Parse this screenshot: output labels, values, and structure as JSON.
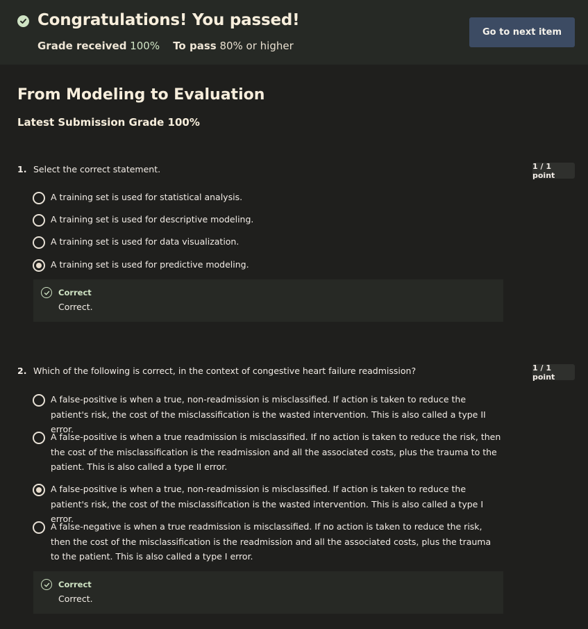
{
  "banner": {
    "title": "Congratulations! You passed!",
    "grade_label": "Grade received",
    "grade_value": "100%",
    "pass_label": "To pass",
    "pass_value": "80% or higher",
    "next_button": "Go to next item"
  },
  "page": {
    "title": "From Modeling to Evaluation",
    "latest_grade": "Latest Submission Grade 100%"
  },
  "questions": [
    {
      "number": "1.",
      "text": "Select the correct statement.",
      "points": "1 / 1 point",
      "options": [
        "A training set is used for statistical analysis.",
        "A training set is used for descriptive modeling.",
        "A training set is used for data visualization.",
        "A training set is used for predictive modeling."
      ],
      "selected_index": 3,
      "feedback_label": "Correct",
      "feedback_text": "Correct."
    },
    {
      "number": "2.",
      "text": "Which of the following is correct, in the context of congestive heart failure readmission?",
      "points": "1 / 1 point",
      "options": [
        "A false-positive is when a true, non-readmission is misclassified. If action is taken to reduce the patient's risk, the cost of the misclassification is the wasted intervention. This is also called a type II error.",
        "A false-positive is when a true readmission is misclassified. If no action is taken to reduce the risk, then the cost of the misclassification is the readmission and all the associated costs, plus the trauma to the patient. This is also called a type II error.",
        "A false-positive is when a true, non-readmission is misclassified. If action is taken to reduce the patient's risk, the cost of the misclassification is the wasted intervention. This is also called a type I error.",
        "A false-negative is when a true readmission is misclassified. If no action is taken to reduce the risk, then the cost of the misclassification is the readmission and all the associated costs, plus the trauma to the patient. This is also called a type I error."
      ],
      "selected_index": 2,
      "feedback_label": "Correct",
      "feedback_text": "Correct."
    }
  ],
  "colors": {
    "background": "#1f1f1d",
    "banner": "#262925",
    "accent_green": "#cfe3c4",
    "button": "#3c4b63"
  }
}
